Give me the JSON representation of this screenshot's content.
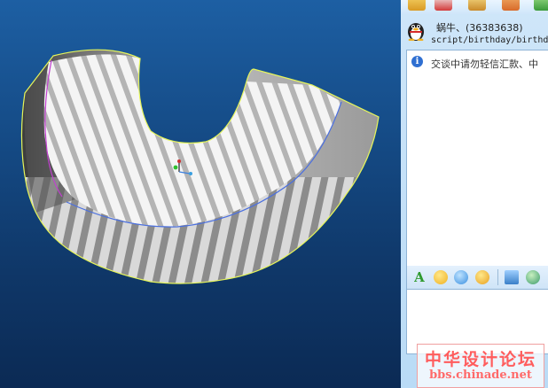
{
  "chat": {
    "contact_name": "蜗牛、(36383638)",
    "url_line": "script/birthday/birthday",
    "notice": "交谈中请勿轻信汇款、中",
    "info_icon": "i"
  },
  "watermark": {
    "title": "中华设计论坛",
    "url": "bbs.chinade.net"
  },
  "icons": {
    "toolbar": [
      "edit-icon",
      "profile-icon",
      "file-transfer-icon",
      "video-icon",
      "app-icon"
    ],
    "emoji_bar": [
      "font-icon",
      "emoji-icon",
      "magic-emoji-icon",
      "wink-icon",
      "screenshot-icon",
      "music-icon"
    ]
  },
  "colors": {
    "viewport_top": "#1d5fa3",
    "viewport_bottom": "#0b2a54",
    "chat_bg": "#cfe6f9",
    "watermark": "#ff5d5d"
  }
}
